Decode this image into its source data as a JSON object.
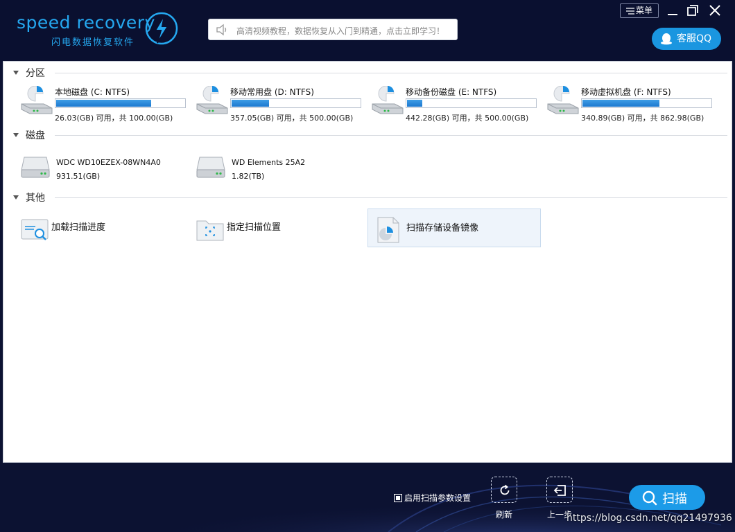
{
  "app": {
    "logo_text": "speed recovery",
    "logo_subtitle": "闪电数据恢复软件",
    "notice": "高清视频教程，数据恢复从入门到精通，点击立即学习！",
    "menu_label": "菜单",
    "qq_label": "客服QQ"
  },
  "sections": {
    "partitions": "分区",
    "disks": "磁盘",
    "other": "其他"
  },
  "partitions": [
    {
      "name": "本地磁盘 (C: NTFS)",
      "info": "26.03(GB) 可用，共 100.00(GB)",
      "used_fraction": 0.74
    },
    {
      "name": "移动常用盘 (D: NTFS)",
      "info": "357.05(GB) 可用，共 500.00(GB)",
      "used_fraction": 0.29
    },
    {
      "name": "移动备份磁盘 (E: NTFS)",
      "info": "442.28(GB) 可用，共 500.00(GB)",
      "used_fraction": 0.12
    },
    {
      "name": "移动虚拟机盘 (F: NTFS)",
      "info": "340.89(GB) 可用，共 862.98(GB)",
      "used_fraction": 0.6
    }
  ],
  "disks": [
    {
      "name": "WDC WD10EZEX-08WN4A0",
      "size": "931.51(GB)"
    },
    {
      "name": "WD Elements 25A2",
      "size": "1.82(TB)"
    }
  ],
  "other": [
    {
      "label": "加载扫描进度",
      "icon": "load-progress-icon"
    },
    {
      "label": "指定扫描位置",
      "icon": "folder-target-icon"
    },
    {
      "label": "扫描存储设备镜像",
      "icon": "image-file-icon"
    }
  ],
  "footer": {
    "option_label": "启用扫描参数设置",
    "refresh_label": "刷新",
    "back_label": "上一步",
    "scan_label": "扫描",
    "watermark": "https://blog.csdn.net/qq21497936"
  },
  "colors": {
    "accent": "#1c9be8",
    "background": "#0c1232",
    "bar": "#1d78cf"
  }
}
